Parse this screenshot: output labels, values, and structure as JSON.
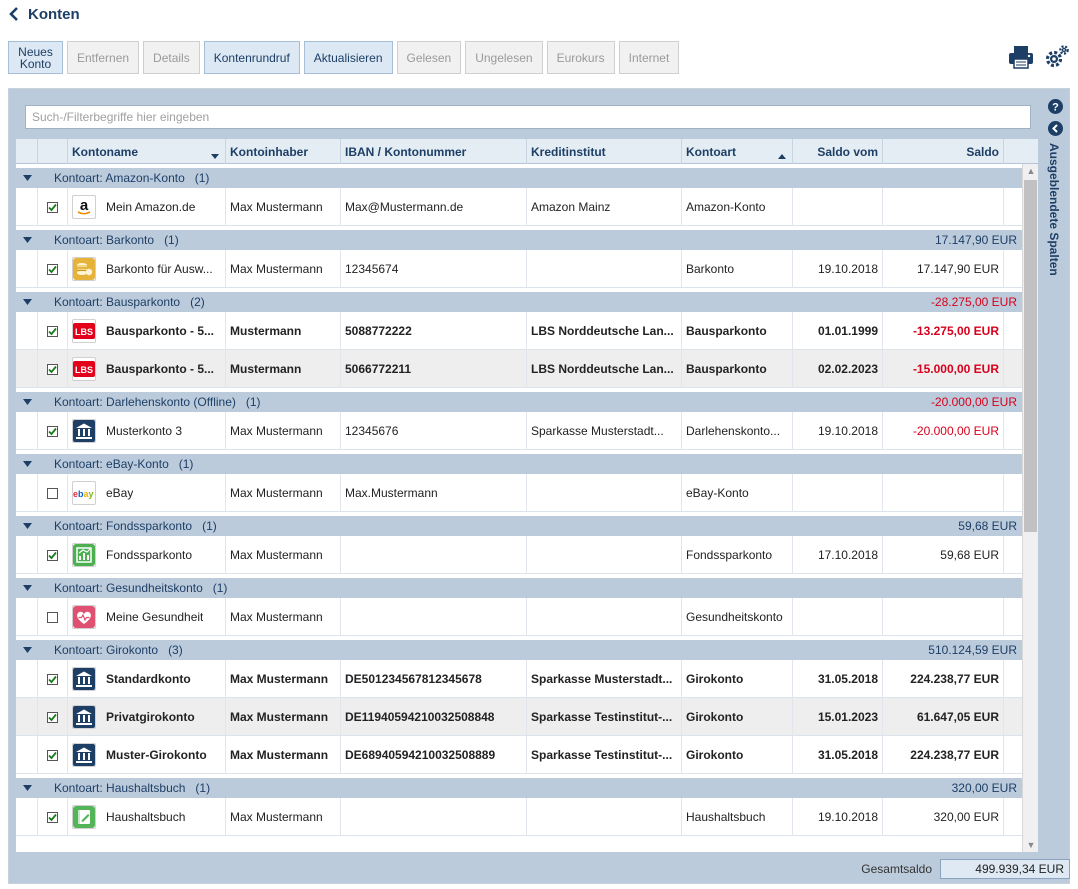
{
  "header": {
    "title": "Konten"
  },
  "toolbar": {
    "buttons": [
      {
        "label": "Neues\nKonto",
        "enabled": true
      },
      {
        "label": "Entfernen",
        "enabled": false
      },
      {
        "label": "Details",
        "enabled": false
      },
      {
        "label": "Kontenrundruf",
        "enabled": true
      },
      {
        "label": "Aktualisieren",
        "enabled": true
      },
      {
        "label": "Gelesen",
        "enabled": false
      },
      {
        "label": "Ungelesen",
        "enabled": false
      },
      {
        "label": "Eurokurs",
        "enabled": false
      },
      {
        "label": "Internet",
        "enabled": false
      }
    ]
  },
  "icons": {
    "print": "printer-icon",
    "settings": "gears-icon",
    "help": "help-icon",
    "collapse": "chevron-left-icon"
  },
  "search": {
    "placeholder": "Such-/Filterbegriffe hier eingeben",
    "value": ""
  },
  "columns": [
    "Kontoname",
    "Kontoinhaber",
    "IBAN / Kontonummer",
    "Kreditinstitut",
    "Kontoart",
    "Saldo vom",
    "Saldo"
  ],
  "groups": [
    {
      "label": "Kontoart: Amazon-Konto",
      "count": "(1)",
      "sum": "",
      "sum_negative": false,
      "rows": [
        {
          "checked": true,
          "icon": "amazon-icon",
          "name": "Mein Amazon.de",
          "owner": "Max Mustermann",
          "iban": "Max@Mustermann.de",
          "bank": "Amazon Mainz",
          "type": "Amazon-Konto",
          "date": "",
          "balance": "",
          "negative": false,
          "bold": false
        }
      ]
    },
    {
      "label": "Kontoart: Barkonto",
      "count": "(1)",
      "sum": "17.147,90 EUR",
      "sum_negative": false,
      "rows": [
        {
          "checked": true,
          "icon": "coins-icon",
          "name": "Barkonto für Ausw...",
          "owner": "Max Mustermann",
          "iban": "12345674",
          "bank": "",
          "type": "Barkonto",
          "date": "19.10.2018",
          "balance": "17.147,90 EUR",
          "negative": false,
          "bold": false
        }
      ]
    },
    {
      "label": "Kontoart: Bausparkonto",
      "count": "(2)",
      "sum": "-28.275,00 EUR",
      "sum_negative": true,
      "rows": [
        {
          "checked": true,
          "icon": "lbs-icon",
          "name": "Bausparkonto - 5...",
          "owner": "Mustermann",
          "iban": "5088772222",
          "bank": "LBS Norddeutsche Lan...",
          "type": "Bausparkonto",
          "date": "01.01.1999",
          "balance": "-13.275,00 EUR",
          "negative": true,
          "bold": true
        },
        {
          "checked": true,
          "icon": "lbs-icon",
          "name": "Bausparkonto - 5...",
          "owner": "Mustermann",
          "iban": "5066772211",
          "bank": "LBS Norddeutsche Lan...",
          "type": "Bausparkonto",
          "date": "02.02.2023",
          "balance": "-15.000,00 EUR",
          "negative": true,
          "bold": true
        }
      ]
    },
    {
      "label": "Kontoart: Darlehenskonto (Offline)",
      "count": "(1)",
      "sum": "-20.000,00 EUR",
      "sum_negative": true,
      "rows": [
        {
          "checked": true,
          "icon": "bank-icon",
          "name": "Musterkonto 3",
          "owner": "Max Mustermann",
          "iban": "12345676",
          "bank": "Sparkasse Musterstadt...",
          "type": "Darlehenskonto...",
          "date": "19.10.2018",
          "balance": "-20.000,00 EUR",
          "negative": true,
          "bold": false
        }
      ]
    },
    {
      "label": "Kontoart: eBay-Konto",
      "count": "(1)",
      "sum": "",
      "sum_negative": false,
      "rows": [
        {
          "checked": false,
          "icon": "ebay-icon",
          "name": "eBay",
          "owner": "Max Mustermann",
          "iban": "Max.Mustermann",
          "bank": "",
          "type": "eBay-Konto",
          "date": "",
          "balance": "",
          "negative": false,
          "bold": false
        }
      ]
    },
    {
      "label": "Kontoart: Fondssparkonto",
      "count": "(1)",
      "sum": "59,68 EUR",
      "sum_negative": false,
      "rows": [
        {
          "checked": true,
          "icon": "fund-chart-icon",
          "name": "Fondssparkonto",
          "owner": "Max Mustermann",
          "iban": "",
          "bank": "",
          "type": "Fondssparkonto",
          "date": "17.10.2018",
          "balance": "59,68 EUR",
          "negative": false,
          "bold": false
        }
      ]
    },
    {
      "label": "Kontoart: Gesundheitskonto",
      "count": "(1)",
      "sum": "",
      "sum_negative": false,
      "rows": [
        {
          "checked": false,
          "icon": "heart-icon",
          "name": "Meine Gesundheit",
          "owner": "Max Mustermann",
          "iban": "",
          "bank": "",
          "type": "Gesundheitskonto",
          "date": "",
          "balance": "",
          "negative": false,
          "bold": false
        }
      ]
    },
    {
      "label": "Kontoart: Girokonto",
      "count": "(3)",
      "sum": "510.124,59 EUR",
      "sum_negative": false,
      "rows": [
        {
          "checked": true,
          "icon": "bank-icon",
          "name": "Standardkonto",
          "owner": "Max Mustermann",
          "iban": "DE501234567812345678",
          "bank": "Sparkasse Musterstadt...",
          "type": "Girokonto",
          "date": "31.05.2018",
          "balance": "224.238,77 EUR",
          "negative": false,
          "bold": true
        },
        {
          "checked": true,
          "icon": "bank-icon",
          "name": "Privatgirokonto",
          "owner": "Max Mustermann",
          "iban": "DE11940594210032508848",
          "bank": "Sparkasse Testinstitut-...",
          "type": "Girokonto",
          "date": "15.01.2023",
          "balance": "61.647,05 EUR",
          "negative": false,
          "bold": true
        },
        {
          "checked": true,
          "icon": "bank-icon",
          "name": "Muster-Girokonto",
          "owner": "Max Mustermann",
          "iban": "DE68940594210032508889",
          "bank": "Sparkasse Testinstitut-...",
          "type": "Girokonto",
          "date": "31.05.2018",
          "balance": "224.238,77 EUR",
          "negative": false,
          "bold": true
        }
      ]
    },
    {
      "label": "Kontoart: Haushaltsbuch",
      "count": "(1)",
      "sum": "320,00 EUR",
      "sum_negative": false,
      "rows": [
        {
          "checked": true,
          "icon": "notebook-icon",
          "name": "Haushaltsbuch",
          "owner": "Max Mustermann",
          "iban": "",
          "bank": "",
          "type": "Haushaltsbuch",
          "date": "19.10.2018",
          "balance": "320,00 EUR",
          "negative": false,
          "bold": false
        }
      ]
    }
  ],
  "sidebar": {
    "label": "Ausgeblendete Spalten"
  },
  "footer": {
    "label": "Gesamtsaldo",
    "value": "499.939,34 EUR"
  },
  "colors": {
    "accent": "#1d3f66",
    "negative": "#d8001c",
    "group_bg": "#bccbdb",
    "header_bg": "#e4ecf4"
  }
}
